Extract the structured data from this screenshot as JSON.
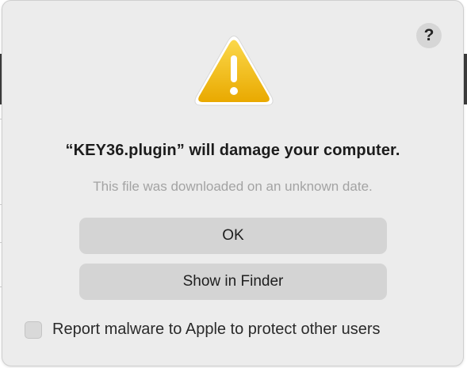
{
  "dialog": {
    "help_label": "?",
    "title": "“KEY36.plugin” will damage your computer.",
    "subtitle": "This file was downloaded on an unknown date.",
    "ok_label": "OK",
    "show_in_finder_label": "Show in Finder",
    "report_checkbox": {
      "label": "Report malware to Apple to protect other users",
      "checked": false
    },
    "icon": "warning-triangle-icon"
  },
  "colors": {
    "dialog_bg": "#ececec",
    "button_bg": "#d4d4d4",
    "warning_yellow": "#f5c11a",
    "subtitle_gray": "#a3a3a3"
  }
}
